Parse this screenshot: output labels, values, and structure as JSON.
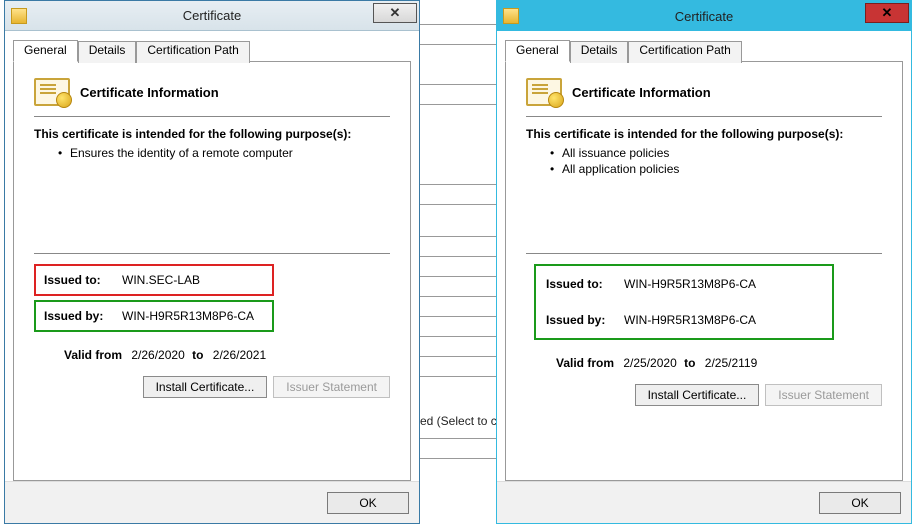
{
  "bg": {
    "peek_text": "ed (Select to c"
  },
  "dialogs": [
    {
      "title": "Certificate",
      "tabs": {
        "general": "General",
        "details": "Details",
        "path": "Certification Path"
      },
      "info_heading": "Certificate Information",
      "purpose_label": "This certificate is intended for the following purpose(s):",
      "bullets": [
        "Ensures the identity of a remote computer"
      ],
      "issued_to_label": "Issued to:",
      "issued_to_value": "WIN.SEC-LAB",
      "issued_by_label": "Issued by:",
      "issued_by_value": "WIN-H9R5R13M8P6-CA",
      "valid_from_label": "Valid from",
      "valid_from": "2/26/2020",
      "valid_to_label": "to",
      "valid_to": "2/26/2021",
      "install_btn": "Install Certificate...",
      "issuer_btn": "Issuer Statement",
      "ok": "OK"
    },
    {
      "title": "Certificate",
      "tabs": {
        "general": "General",
        "details": "Details",
        "path": "Certification Path"
      },
      "info_heading": "Certificate Information",
      "purpose_label": "This certificate is intended for the following purpose(s):",
      "bullets": [
        "All issuance policies",
        "All application policies"
      ],
      "issued_to_label": "Issued to:",
      "issued_to_value": "WIN-H9R5R13M8P6-CA",
      "issued_by_label": "Issued by:",
      "issued_by_value": "WIN-H9R5R13M8P6-CA",
      "valid_from_label": "Valid from",
      "valid_from": "2/25/2020",
      "valid_to_label": "to",
      "valid_to": "2/25/2119",
      "install_btn": "Install Certificate...",
      "issuer_btn": "Issuer Statement",
      "ok": "OK"
    }
  ]
}
